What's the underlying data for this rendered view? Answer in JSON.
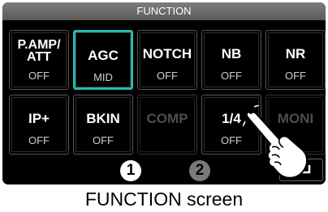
{
  "title": "FUNCTION",
  "buttons": [
    {
      "id": "p-amp-att",
      "label": "P.AMP/ ATT",
      "value": "OFF",
      "selected": false,
      "disabled": false
    },
    {
      "id": "agc",
      "label": "AGC",
      "value": "MID",
      "selected": true,
      "disabled": false
    },
    {
      "id": "notch",
      "label": "NOTCH",
      "value": "OFF",
      "selected": false,
      "disabled": false
    },
    {
      "id": "nb",
      "label": "NB",
      "value": "OFF",
      "selected": false,
      "disabled": false
    },
    {
      "id": "nr",
      "label": "NR",
      "value": "OFF",
      "selected": false,
      "disabled": false
    },
    {
      "id": "ip-plus",
      "label": "IP+",
      "value": "OFF",
      "selected": false,
      "disabled": false
    },
    {
      "id": "bkin",
      "label": "BKIN",
      "value": "OFF",
      "selected": false,
      "disabled": false
    },
    {
      "id": "comp",
      "label": "COMP",
      "value": "",
      "selected": false,
      "disabled": true
    },
    {
      "id": "quarter",
      "label": "1/4",
      "value": "OFF",
      "selected": false,
      "disabled": false
    },
    {
      "id": "moni",
      "label": "MONI",
      "value": "",
      "selected": false,
      "disabled": true
    }
  ],
  "pages": [
    "1",
    "2"
  ],
  "current_page": "1",
  "back_icon": "return-arrow-icon",
  "pointer_icon": "tapping-hand-icon",
  "caption": "FUNCTION screen",
  "colors": {
    "selected_border": "#25b9b5",
    "screen_bg": "#000000",
    "titlebar": "#6a6a6a"
  }
}
